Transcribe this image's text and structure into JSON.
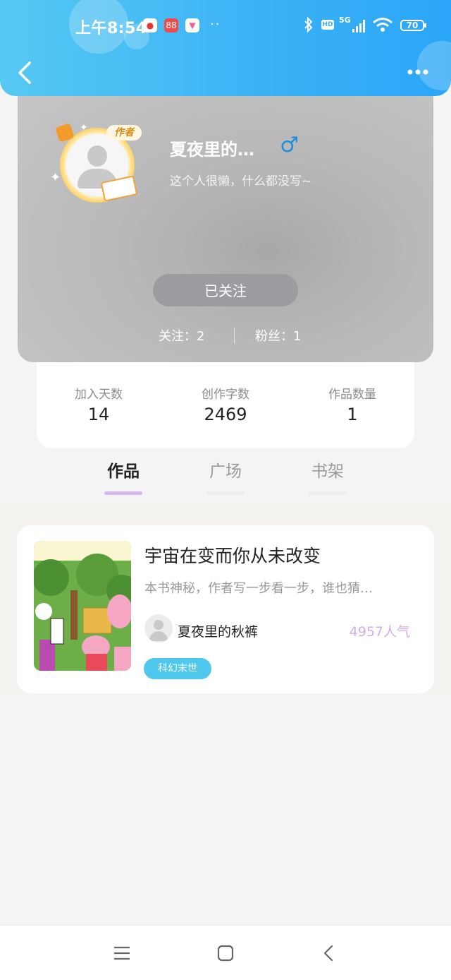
{
  "status_bar": {
    "time": "上午8:54",
    "dots": "··",
    "network": "5G",
    "hd": "HD",
    "battery": "70"
  },
  "header": {
    "back_icon": "chevron-left-icon",
    "more_icon": "more-horizontal-icon"
  },
  "profile": {
    "author_badge": "作者",
    "name": "夏夜里的…",
    "gender_symbol": "♂",
    "bio": "这个人很懒，什么都没写~",
    "follow_button": "已关注",
    "following": "关注：2",
    "followers": "粉丝：1"
  },
  "stats": [
    {
      "label": "加入天数",
      "value": "14"
    },
    {
      "label": "创作字数",
      "value": "2469"
    },
    {
      "label": "作品数量",
      "value": "1"
    }
  ],
  "tabs": [
    {
      "label": "作品",
      "active": true
    },
    {
      "label": "广场",
      "active": false
    },
    {
      "label": "书架",
      "active": false
    }
  ],
  "book": {
    "title": "宇宙在变而你从未改变",
    "description": "本书神秘，作者写一步看一步，谁也猜…",
    "author": "夏夜里的秋裤",
    "popularity": "4957人气",
    "genre": "科幻末世"
  },
  "colors": {
    "header_start": "#56c9f2",
    "header_end": "#2aa6f8",
    "tab_indicator": "#d7b6ee",
    "popularity": "#d2aee8",
    "genre_tag": "#4fc8ee",
    "gender": "#1e8ee0"
  }
}
